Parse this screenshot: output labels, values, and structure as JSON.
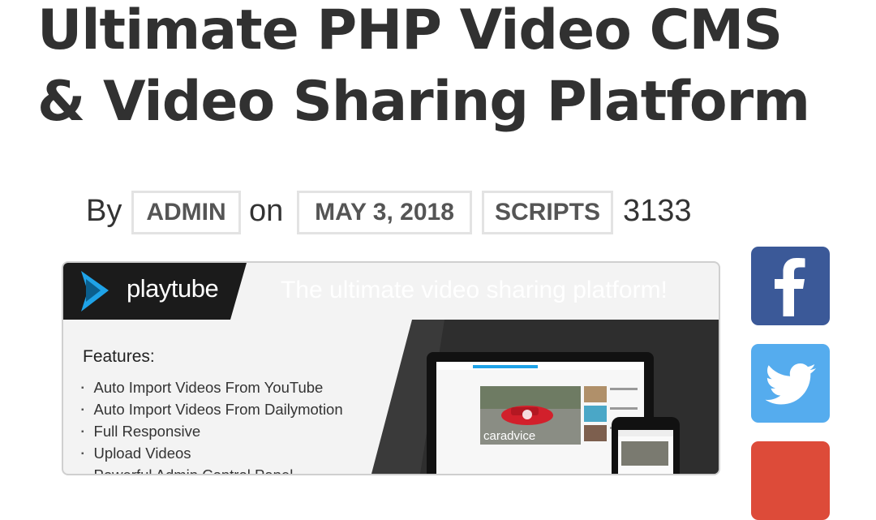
{
  "post": {
    "title_line1": "Ultimate PHP Video CMS",
    "title_line2": "& Video Sharing Platform",
    "meta": {
      "by_label": "By",
      "author": "ADMIN",
      "on_label": "on",
      "date": "MAY 3, 2018",
      "category": "SCRIPTS",
      "views": "3133"
    }
  },
  "banner": {
    "brand": "playtube",
    "tagline": "The ultimate video sharing platform!",
    "features_title": "Features:",
    "features": [
      "Auto Import Videos From YouTube",
      "Auto Import Videos From Dailymotion",
      "Full Responsive",
      "Upload Videos",
      "Powerful Admin Control Panel"
    ],
    "video_label": "caradvice"
  },
  "share": {
    "facebook_icon": "facebook-icon",
    "twitter_icon": "twitter-icon",
    "googleplus_icon": "google-plus-icon"
  },
  "colors": {
    "facebook": "#3b5998",
    "twitter": "#55acee",
    "googleplus": "#dd4b39",
    "banner_blue": "#1fa3e8"
  }
}
